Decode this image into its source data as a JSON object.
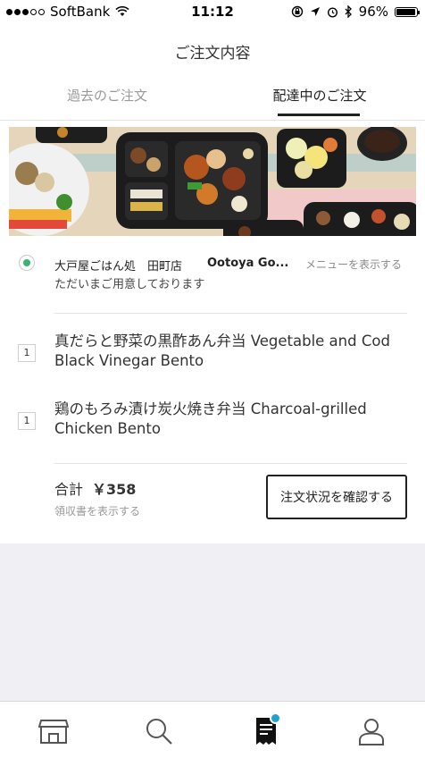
{
  "status_bar": {
    "carrier": "SoftBank",
    "time": "11:12",
    "battery": "96%",
    "battery_level": 0.96,
    "signal_bars": 3
  },
  "header": {
    "title": "ご注文内容",
    "tabs": [
      {
        "label": "過去のご注文",
        "active": false
      },
      {
        "label": "配達中のご注文",
        "active": true
      }
    ]
  },
  "order": {
    "store_name": "大戸屋ごはん処　田町店",
    "store_brand": "Ootoya Go...",
    "menu_link": "メニューを表示する",
    "status": "ただいまご用意しております",
    "items": [
      {
        "qty": "1",
        "name": "真だらと野菜の黒酢あん弁当 Vegetable and Cod Black Vinegar Bento"
      },
      {
        "qty": "1",
        "name": "鶏のもろみ漬け炭火焼き弁当 Charcoal-grilled Chicken Bento"
      }
    ],
    "total_label": "合計",
    "total_amount": "￥358",
    "receipt_link": "領収書を表示する",
    "status_button": "注文状況を確認する"
  },
  "bottom_nav": [
    "store-icon",
    "search-icon",
    "receipt-icon",
    "account-icon"
  ],
  "colors": {
    "accent_green": "#3cb371",
    "badge_blue": "#1fa1d3",
    "text_dark": "#222222",
    "text_muted": "#999999"
  }
}
